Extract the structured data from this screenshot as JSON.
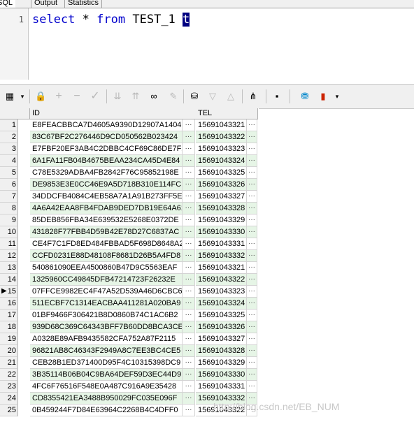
{
  "tabs": {
    "sql": "SQL",
    "output": "Output",
    "statistics": "Statistics"
  },
  "editor": {
    "line_number": "1",
    "kw_select": "select",
    "star": "*",
    "kw_from": "from",
    "table": "TEST_1",
    "alias": "t"
  },
  "toolbar": {
    "icons": [
      "grid-menu-icon",
      "lock-icon",
      "add-record-icon",
      "delete-record-icon",
      "post-edit-icon",
      "filter-down-icon",
      "filter-clear-icon",
      "find-binoculars-icon",
      "eraser-icon",
      "fetch-icon",
      "sort-down-icon",
      "sort-up-icon",
      "network-icon",
      "save-icon",
      "export-db-icon",
      "chart-icon"
    ]
  },
  "grid": {
    "columns": [
      "ID",
      "TEL"
    ],
    "cell_ellipsis": "···",
    "current_row_indicator": "▶",
    "rows": [
      {
        "n": "1",
        "id": "E8FEACBBCA7D4605A9390D12907A1404",
        "tel": "15691043321"
      },
      {
        "n": "2",
        "id": "83C67BF2C276446D9CD050562B023424",
        "tel": "15691043322"
      },
      {
        "n": "3",
        "id": "E7FBF20EF3AB4C2DBBC4CF69C86DE7F2",
        "tel": "15691043323"
      },
      {
        "n": "4",
        "id": "6A1FA11FB04B4675BEAA234CA45D4E84",
        "tel": "15691043324"
      },
      {
        "n": "5",
        "id": "C78E5329ADBA4FB2842F76C95852198E",
        "tel": "15691043325"
      },
      {
        "n": "6",
        "id": "DE9853E3E0CC46E9A5D718B310E114FC",
        "tel": "15691043326"
      },
      {
        "n": "7",
        "id": "34DDCFB4084C4EB58A7A1A91B273FF5E",
        "tel": "15691043327"
      },
      {
        "n": "8",
        "id": "4A6A42EAA8FB4FDAB9DED7DB19E64A61",
        "tel": "15691043328"
      },
      {
        "n": "9",
        "id": "85DEB856FBA34E639532E5268E0372DE",
        "tel": "15691043329"
      },
      {
        "n": "10",
        "id": "431828F77FBB4D59B42E78D27C6837AC",
        "tel": "15691043330"
      },
      {
        "n": "11",
        "id": "CE4F7C1FD8ED484FBBAD5F698D8648A2",
        "tel": "15691043331"
      },
      {
        "n": "12",
        "id": "CCFD0231E88D48108F8681D26B5A4FD8",
        "tel": "15691043332"
      },
      {
        "n": "13",
        "id": "540861090EEA4500860B47D9C5563EAF",
        "tel": "15691043321"
      },
      {
        "n": "14",
        "id": "1325960CC49845DFB47214723F26232E",
        "tel": "15691043322"
      },
      {
        "n": "15",
        "id": "07FFCE9982EC4F47A52D539A46D6CBC6",
        "tel": "15691043323"
      },
      {
        "n": "16",
        "id": "511ECBF7C1314EACBAA411281A020BA9",
        "tel": "15691043324"
      },
      {
        "n": "17",
        "id": "01BF9466F306421B8D0860B74C1AC6B2",
        "tel": "15691043325"
      },
      {
        "n": "18",
        "id": "939D68C369C64343BFF7B60DD8BCA3CE",
        "tel": "15691043326"
      },
      {
        "n": "19",
        "id": "A0328E89AFB9435582CFA752A87F2115",
        "tel": "15691043327"
      },
      {
        "n": "20",
        "id": "96821AB8C46343F2949A8C7EE3BC4CE5",
        "tel": "15691043328"
      },
      {
        "n": "21",
        "id": "CEB28B1ED371400D95F4C10315398DC9",
        "tel": "15691043329"
      },
      {
        "n": "22",
        "id": "3B35114B06B04C9BA64DEF59D3EC44D9",
        "tel": "15691043330"
      },
      {
        "n": "23",
        "id": "4FC6F76516F548E0A487C916A9E35428",
        "tel": "15691043331"
      },
      {
        "n": "24",
        "id": "CD8355421EA3488B950029FC035E096F",
        "tel": "15691043332"
      },
      {
        "n": "25",
        "id": "0B459244F7D84E63964C2268B4C4DFF0",
        "tel": "15691043322"
      }
    ]
  },
  "watermark": "http://blog.csdn.net/EB_NUM",
  "colors": {
    "keyword": "#0000cc",
    "alias_highlight": "#000080",
    "alt_row": "#e6f5e6"
  }
}
